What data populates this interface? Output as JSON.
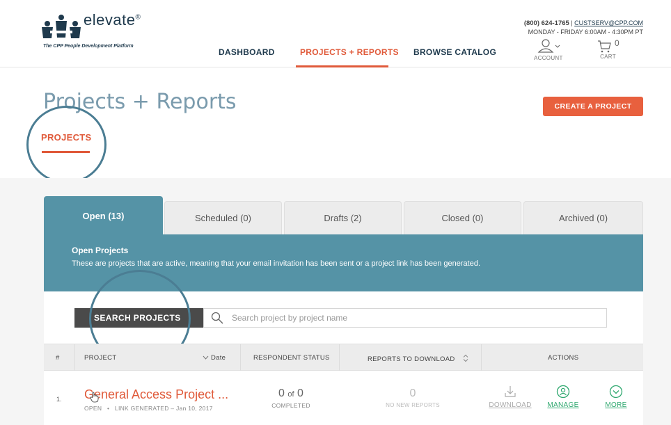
{
  "header": {
    "logo_word": "elevate",
    "logo_reg": "®",
    "logo_tagline": "The CPP People Development Platform",
    "nav": [
      {
        "label": "DASHBOARD"
      },
      {
        "label": "PROJECTS + REPORTS"
      },
      {
        "label": "BROWSE CATALOG"
      }
    ],
    "phone": "(800) 624-1765",
    "sep": "|",
    "email": "CUSTSERV@CPP.COM",
    "hours": "MONDAY - FRIDAY 6:00AM - 4:30PM PT",
    "account_label": "ACCOUNT",
    "cart_label": "CART",
    "cart_count": "0"
  },
  "page": {
    "title": "Projects + Reports",
    "create_button": "CREATE A PROJECT",
    "sub_tab": "PROJECTS"
  },
  "tabs": [
    {
      "label": "Open (13)"
    },
    {
      "label": "Scheduled (0)"
    },
    {
      "label": "Drafts (2)"
    },
    {
      "label": "Closed (0)"
    },
    {
      "label": "Archived (0)"
    }
  ],
  "panel": {
    "title": "Open Projects",
    "description": "These are projects that are active, meaning that your email invitation has been sent or a project link has been generated."
  },
  "search": {
    "button": "SEARCH PROJECTS",
    "placeholder": "Search project by project name"
  },
  "table": {
    "headers": {
      "num": "#",
      "project": "PROJECT",
      "date": "Date",
      "respondent": "RESPONDENT STATUS",
      "reports": "REPORTS TO DOWNLOAD",
      "actions": "ACTIONS"
    },
    "rows": [
      {
        "num": "1.",
        "name": "General Access Project ...",
        "status": "OPEN",
        "dot": "•",
        "meta": "LINK GENERATED – Jan 10, 2017",
        "completed": "0",
        "of": "of",
        "total": "0",
        "completed_label": "COMPLETED",
        "reports_count": "0",
        "reports_label": "NO NEW REPORTS",
        "download": "DOWNLOAD",
        "manage": "MANAGE",
        "more": "MORE"
      }
    ]
  },
  "colors": {
    "accent": "#e05a3a",
    "teal": "#5593a6",
    "navy": "#1f3a4d",
    "green": "#2fa86f"
  }
}
